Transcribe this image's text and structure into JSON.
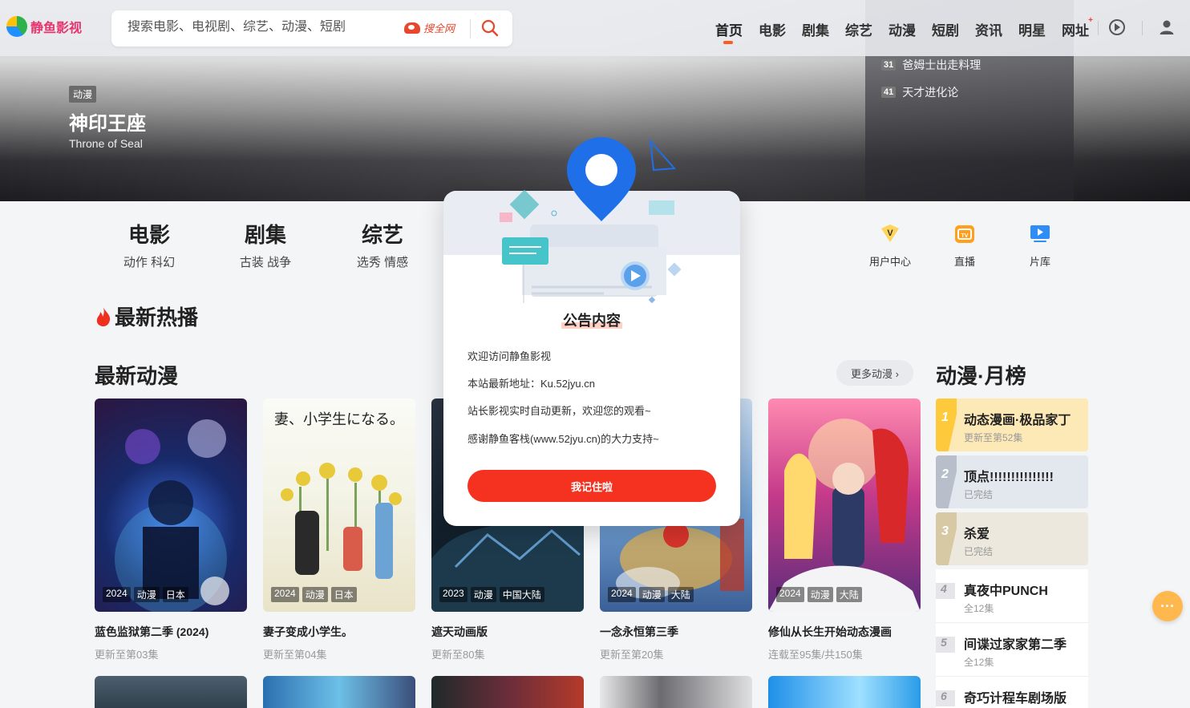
{
  "header": {
    "logo_text": "静鱼影视",
    "search_placeholder": "搜索电影、电视剧、综艺、动漫、短剧",
    "search_engine": "搜全网",
    "nav": [
      "首页",
      "电影",
      "剧集",
      "综艺",
      "动漫",
      "短剧",
      "资讯",
      "明星",
      "网址"
    ]
  },
  "hero": {
    "tag": "动漫",
    "title": "神印王座",
    "subtitle": "Throne of Seal",
    "ranks": [
      {
        "num": "31",
        "title": "爸姆士出走料理"
      },
      {
        "num": "41",
        "title": "天才进化论"
      }
    ]
  },
  "categories": [
    {
      "title": "电影",
      "sub": "动作  科幻"
    },
    {
      "title": "剧集",
      "sub": "古装  战争"
    },
    {
      "title": "综艺",
      "sub": "选秀  情感"
    }
  ],
  "quick_links": [
    "用户中心",
    "直播",
    "片库"
  ],
  "hot_title": "最新热播",
  "anime": {
    "title": "最新动漫",
    "more": "更多动漫 ›",
    "cards": [
      {
        "title": "蓝色监狱第二季 (2024)",
        "sub": "更新至第03集",
        "tags": [
          "2024",
          "动漫",
          "日本"
        ]
      },
      {
        "title": "妻子变成小学生。",
        "sub": "更新至第04集",
        "tags": [
          "2024",
          "动漫",
          "日本"
        ]
      },
      {
        "title": "遮天动画版",
        "sub": "更新至80集",
        "tags": [
          "2023",
          "动漫",
          "中国大陆"
        ]
      },
      {
        "title": "一念永恒第三季",
        "sub": "更新至第20集",
        "tags": [
          "2024",
          "动漫",
          "大陆"
        ]
      },
      {
        "title": "修仙从长生开始动态漫画",
        "sub": "连载至95集/共150集",
        "tags": [
          "2024",
          "动漫",
          "大陆"
        ]
      }
    ],
    "poster_text": {
      "card2": "妻、小学生になる。"
    }
  },
  "monthly": {
    "title": "动漫·月榜",
    "items": [
      {
        "num": "1",
        "title": "动态漫画·极品家丁",
        "sub": "更新至第52集"
      },
      {
        "num": "2",
        "title": "顶点!!!!!!!!!!!!!!!",
        "sub": "已完结"
      },
      {
        "num": "3",
        "title": "杀爱",
        "sub": "已完结"
      },
      {
        "num": "4",
        "title": "真夜中PUNCH",
        "sub": "全12集"
      },
      {
        "num": "5",
        "title": "间谍过家家第二季",
        "sub": "全12集"
      },
      {
        "num": "6",
        "title": "奇巧计程车剧场版",
        "sub": ""
      }
    ]
  },
  "modal": {
    "title": "公告内容",
    "lines": [
      "欢迎访问静鱼影视",
      "本站最新地址：Ku.52jyu.cn",
      "站长影视实时自动更新，欢迎您的观看~",
      "感谢静鱼客栈(www.52jyu.cn)的大力支持~"
    ],
    "button": "我记住啦"
  },
  "colors": {
    "accent": "#f5311f",
    "nav_indicator": "#ff5a1f",
    "rank1": "#ffc93c",
    "rank2": "#b8bfca",
    "rank3": "#d6c9a3"
  }
}
